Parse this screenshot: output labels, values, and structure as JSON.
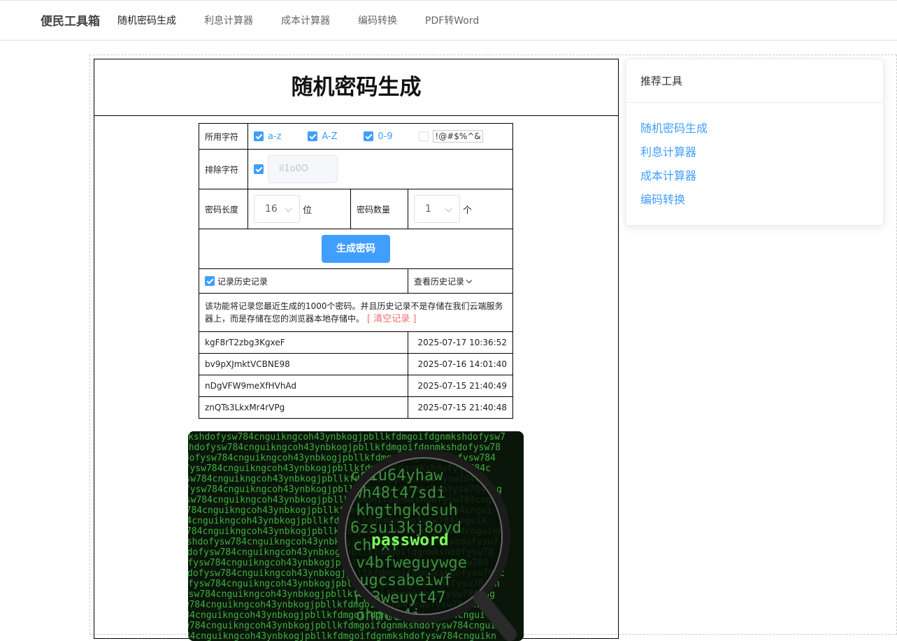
{
  "nav": {
    "brand": "便民工具箱",
    "items": [
      {
        "label": "随机密码生成"
      },
      {
        "label": "利息计算器"
      },
      {
        "label": "成本计算器"
      },
      {
        "label": "编码转换"
      },
      {
        "label": "PDF转Word"
      }
    ]
  },
  "main": {
    "title": "随机密码生成",
    "form": {
      "chars_label": "所用字符",
      "options": [
        {
          "label": "a-z",
          "checked": true
        },
        {
          "label": "A-Z",
          "checked": true
        },
        {
          "label": "0-9",
          "checked": true
        },
        {
          "label": "!@#$%^&",
          "checked": false
        }
      ],
      "exclude_label": "排除字符",
      "exclude_value": "il1o0O",
      "length_label": "密码长度",
      "length_value": "16",
      "length_unit": "位",
      "count_label": "密码数量",
      "count_value": "1",
      "count_unit": "个",
      "generate_button": "生成密码",
      "record_history_label": "记录历史记录",
      "view_history_label": "查看历史记录",
      "history_notice": "该功能将记录您最近生成的1000个密码。并且历史记录不是存储在我们云端服务器上，而是存储在您的浏览器本地存储中。",
      "clear_label": "[ 清空记录 ]"
    },
    "history": [
      {
        "password": "kgF8rT2zbg3KgxeF",
        "time": "2025-07-17 10:36:52"
      },
      {
        "password": "bv9pXJmktVCBNE98",
        "time": "2025-07-16 14:01:40"
      },
      {
        "password": "nDgVFW9meXfHVhAd",
        "time": "2025-07-15 21:40:49"
      },
      {
        "password": "znQTs3LkxMr4rVPg",
        "time": "2025-07-15 21:40:48"
      }
    ],
    "image": {
      "highlight_word": "password",
      "code_text": "kshdofysw784cnguikngcoh43ynbkogjpbllkfdmgoifdgnm"
    }
  },
  "sidebar": {
    "title": "推荐工具",
    "links": [
      {
        "label": "随机密码生成"
      },
      {
        "label": "利息计算器"
      },
      {
        "label": "成本计算器"
      },
      {
        "label": "编码转换"
      }
    ]
  },
  "colors": {
    "accent": "#409eff",
    "danger": "#f56c6c",
    "matrix_green": "#3fae3f"
  }
}
